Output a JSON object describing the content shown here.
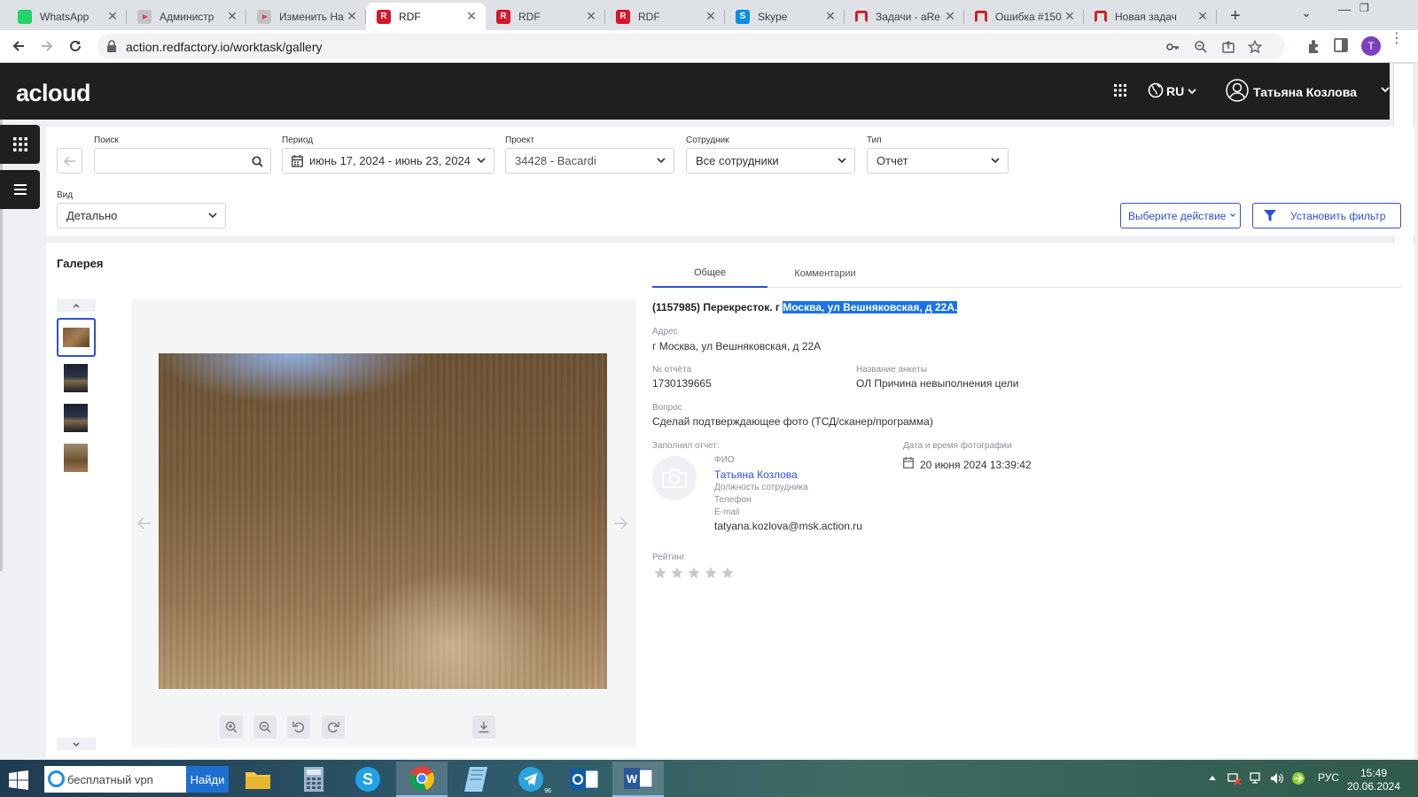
{
  "browser": {
    "tabs": [
      {
        "title": "WhatsApp",
        "favicon": "whatsapp-icon"
      },
      {
        "title": "Администр",
        "favicon": "youtube-like-icon"
      },
      {
        "title": "Изменить На",
        "favicon": "youtube-like-icon"
      },
      {
        "title": "RDF",
        "favicon": "rdf-icon"
      },
      {
        "title": "RDF",
        "favicon": "rdf-icon"
      },
      {
        "title": "RDF",
        "favicon": "rdf-icon"
      },
      {
        "title": "Skype",
        "favicon": "skype-icon"
      },
      {
        "title": "Задачи - aRe",
        "favicon": "redmine-icon"
      },
      {
        "title": "Ошибка #150",
        "favicon": "redmine-icon"
      },
      {
        "title": "Новая задач",
        "favicon": "redmine-icon"
      }
    ],
    "active_tab_index": 3,
    "url": "action.redfactory.io/worktask/gallery",
    "profile_initial": "T",
    "new_tab": "+",
    "close_glyph": "✕",
    "tab_list": "⌄",
    "minimize": "—",
    "restore": "❐",
    "menu": "⋮"
  },
  "header": {
    "logo": "acloud",
    "language": "RU",
    "user_name": "Татьяна Козлова"
  },
  "filters": {
    "search_label": "Поиск",
    "search_value": "",
    "period_label": "Период",
    "period_value": "июнь 17, 2024 - июнь 23, 2024",
    "project_label": "Проект",
    "project_value": "34428 - Bacardi",
    "employee_label": "Сотрудник",
    "employee_value": "Все сотрудники",
    "type_label": "Тип",
    "type_value": "Отчет",
    "view_label": "Вид",
    "view_value": "Детально",
    "action_button": "Выберите действие",
    "filter_button": "Установить фильтр"
  },
  "gallery": {
    "title": "Галерея",
    "thumbnail_count": 4,
    "selected_thumbnail": 1,
    "tabs": [
      "Общее",
      "Комментарии"
    ],
    "active_tab": 0,
    "detail": {
      "title_prefix": "(1157985) Перекресток. г ",
      "title_highlight": "Москва, ул Вешняковская, д 22А.",
      "address_label": "Адрес",
      "address": "г Москва, ул Вешняковская, д 22А",
      "report_no_label": "№ отчёта",
      "report_no": "1730139665",
      "survey_label": "Название анкеты",
      "survey": "ОЛ Причина невыполнения цели",
      "question_label": "Вопрос",
      "question": "Сделай подтверждающее фото (ТСД/сканер/программа)",
      "filled_by_label": "Заполнил отчет:",
      "fio_label": "ФИО",
      "fio": "Татьяна Козлова",
      "position_label": "Должность сотрудника",
      "phone_label": "Телефон",
      "email_label": "E-mail",
      "email": "tatyana.kozlova@msk.action.ru",
      "photo_datetime_label": "Дата и время фотографии",
      "photo_datetime": "20 июня 2024 13:39:42",
      "rating_label": "Рейтинг",
      "rating": 0,
      "rating_max": 5
    }
  },
  "taskbar": {
    "search_text": "бесплатный vpn",
    "search_button": "Найди",
    "telegram_badge": "96",
    "language": "РУС",
    "time": "15:49",
    "date": "20.06.2024"
  },
  "colors": {
    "accent": "#2d4fd8",
    "header_bg": "#1f1f1f",
    "logo_red": "#e31e24",
    "highlight": "#1a73e8"
  }
}
